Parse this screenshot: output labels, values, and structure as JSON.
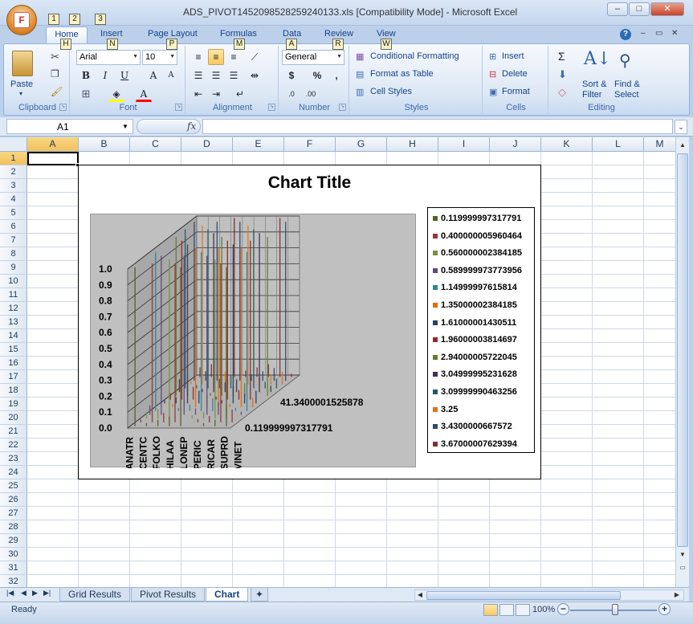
{
  "window": {
    "title": "ADS_PIVOT1452098528259240133.xls  [Compatibility Mode] - Microsoft Excel",
    "office_key": "F",
    "qat_keys": [
      "1",
      "2",
      "3"
    ],
    "min": "–",
    "max": "□",
    "close": "✕"
  },
  "ribbon_tabs": [
    {
      "label": "Home",
      "key": "H"
    },
    {
      "label": "Insert",
      "key": "N"
    },
    {
      "label": "Page Layout",
      "key": "P"
    },
    {
      "label": "Formulas",
      "key": "M"
    },
    {
      "label": "Data",
      "key": "A"
    },
    {
      "label": "Review",
      "key": "R"
    },
    {
      "label": "View",
      "key": "W"
    }
  ],
  "ribbon": {
    "clipboard": {
      "label": "Clipboard",
      "paste": "Paste"
    },
    "font": {
      "label": "Font",
      "name": "Arial",
      "size": "10",
      "bold": "B",
      "italic": "I",
      "underline": "U",
      "grow": "A",
      "shrink": "A"
    },
    "alignment": {
      "label": "Alignment"
    },
    "number": {
      "label": "Number",
      "format": "General",
      "currency": "$",
      "percent": "%",
      "comma": ","
    },
    "styles": {
      "label": "Styles",
      "conditional": "Conditional Formatting",
      "table": "Format as Table",
      "cell_styles": "Cell Styles"
    },
    "cells": {
      "label": "Cells",
      "insert": "Insert",
      "delete": "Delete",
      "format": "Format"
    },
    "editing": {
      "label": "Editing",
      "sigma": "Σ",
      "sort": "Sort &",
      "sort2": "Filter",
      "find": "Find &",
      "find2": "Select"
    }
  },
  "formula_bar": {
    "name_box": "A1",
    "fx": "fx",
    "value": ""
  },
  "columns": [
    "A",
    "B",
    "C",
    "D",
    "E",
    "F",
    "G",
    "H",
    "I",
    "J",
    "K",
    "L",
    "M"
  ],
  "rows": [
    "1",
    "2",
    "3",
    "4",
    "5",
    "6",
    "7",
    "8",
    "9",
    "10",
    "11",
    "12",
    "13",
    "14",
    "15",
    "16",
    "17",
    "18",
    "19",
    "20",
    "21",
    "22",
    "23",
    "24",
    "25",
    "26",
    "27",
    "28",
    "29",
    "30",
    "31",
    "32"
  ],
  "chart_data": {
    "type": "bar",
    "title": "Chart Title",
    "categories": [
      "ANATR",
      "CENTC",
      "FOLKO",
      "HILAA",
      "LONEP",
      "PERIC",
      "RICAR",
      "SUPRD",
      "VINET"
    ],
    "yticks": [
      "1.0",
      "0.9",
      "0.8",
      "0.7",
      "0.6",
      "0.5",
      "0.4",
      "0.3",
      "0.2",
      "0.1",
      "0.0"
    ],
    "ylim": [
      0,
      1
    ],
    "depth_labels": [
      "41.3400001525878",
      "0.119999997317791"
    ],
    "legend_placement": "right",
    "series": [
      {
        "name": "0.119999997317791",
        "color": "#4f6228"
      },
      {
        "name": "0.400000005960464",
        "color": "#953735"
      },
      {
        "name": "0.560000002384185",
        "color": "#77933c"
      },
      {
        "name": "0.589999973773956",
        "color": "#604a7b"
      },
      {
        "name": "1.14999997615814",
        "color": "#31859c"
      },
      {
        "name": "1.35000002384185",
        "color": "#e46c0a"
      },
      {
        "name": "1.61000001430511",
        "color": "#254061"
      },
      {
        "name": "1.96000003814697",
        "color": "#8e2b2b"
      },
      {
        "name": "2.94000005722045",
        "color": "#5f7f2e"
      },
      {
        "name": "3.04999995231628",
        "color": "#403151"
      },
      {
        "name": "3.09999990463256",
        "color": "#215968"
      },
      {
        "name": "3.25",
        "color": "#d9791e"
      },
      {
        "name": "3.4300000667572",
        "color": "#2f4a6e"
      },
      {
        "name": "3.67000007629394",
        "color": "#7f3030"
      }
    ]
  },
  "sheets": [
    {
      "label": "Grid Results",
      "active": false
    },
    {
      "label": "Pivot Results",
      "active": false
    },
    {
      "label": "Chart",
      "active": true
    }
  ],
  "status": {
    "text": "Ready",
    "zoom": "100%",
    "minus": "−",
    "plus": "+"
  }
}
